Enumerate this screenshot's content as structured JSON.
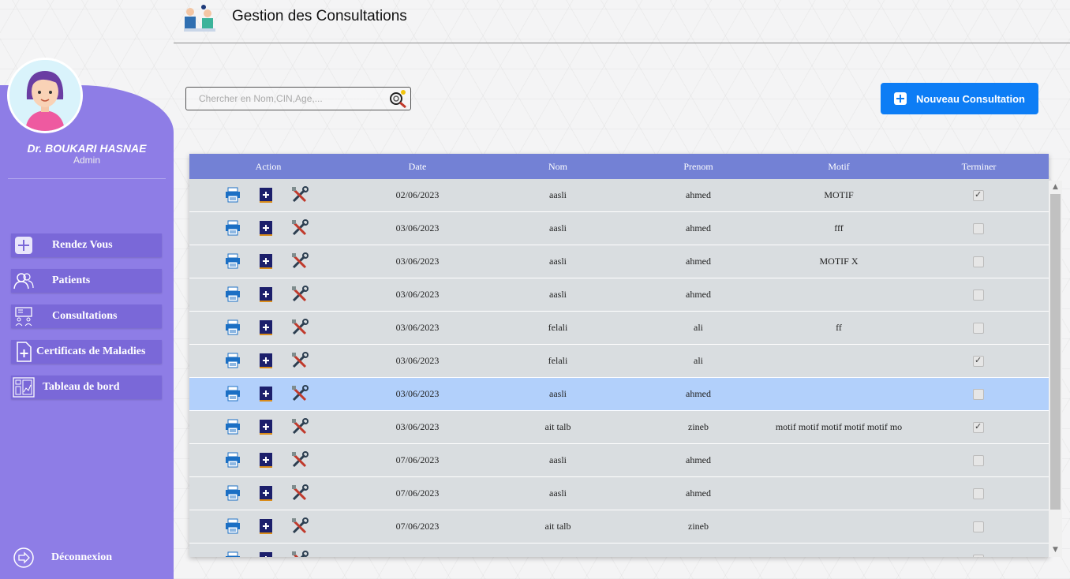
{
  "header": {
    "title": "Gestion des Consultations"
  },
  "sidebar": {
    "doctor_name": "Dr. BOUKARI HASNAE",
    "doctor_role": "Admin",
    "items": [
      {
        "label": "Rendez Vous",
        "icon": "plus-square-icon"
      },
      {
        "label": "Patients",
        "icon": "users-icon"
      },
      {
        "label": "Consultations",
        "icon": "consultation-icon"
      },
      {
        "label": "Certificats de Maladies",
        "icon": "document-plus-icon"
      },
      {
        "label": "Tableau de bord",
        "icon": "dashboard-icon"
      }
    ],
    "logout_label": "Déconnexion"
  },
  "search": {
    "placeholder": "Chercher en Nom,CIN,Age,..."
  },
  "new_button": {
    "label": "Nouveau Consultation"
  },
  "table": {
    "columns": [
      "Action",
      "Date",
      "Nom",
      "Prenom",
      "Motif",
      "Terminer"
    ],
    "rows": [
      {
        "date": "02/06/2023",
        "nom": "aasli",
        "prenom": "ahmed",
        "motif": "MOTIF",
        "terminer": true
      },
      {
        "date": "03/06/2023",
        "nom": "aasli",
        "prenom": "ahmed",
        "motif": "fff",
        "terminer": false
      },
      {
        "date": "03/06/2023",
        "nom": "aasli",
        "prenom": "ahmed",
        "motif": "MOTIF X",
        "terminer": false
      },
      {
        "date": "03/06/2023",
        "nom": "aasli",
        "prenom": "ahmed",
        "motif": "",
        "terminer": false
      },
      {
        "date": "03/06/2023",
        "nom": "felali",
        "prenom": "ali",
        "motif": "ff",
        "terminer": false
      },
      {
        "date": "03/06/2023",
        "nom": "felali",
        "prenom": "ali",
        "motif": "",
        "terminer": true
      },
      {
        "date": "03/06/2023",
        "nom": "aasli",
        "prenom": "ahmed",
        "motif": "",
        "terminer": false,
        "selected": true
      },
      {
        "date": "03/06/2023",
        "nom": "ait talb",
        "prenom": "zineb",
        "motif": "motif motif motif motif motif mo",
        "terminer": true
      },
      {
        "date": "07/06/2023",
        "nom": "aasli",
        "prenom": "ahmed",
        "motif": "",
        "terminer": false
      },
      {
        "date": "07/06/2023",
        "nom": "aasli",
        "prenom": "ahmed",
        "motif": "",
        "terminer": false
      },
      {
        "date": "07/06/2023",
        "nom": "ait talb",
        "prenom": "zineb",
        "motif": "",
        "terminer": false
      },
      {
        "date": "",
        "nom": "",
        "prenom": "",
        "motif": "",
        "terminer": false
      }
    ]
  },
  "colors": {
    "sidebar": "#8e7de6",
    "nav_item": "#7a68d8",
    "table_header": "#7381d5",
    "selected_row": "#b2d0fb",
    "primary_button": "#0d7df5"
  }
}
